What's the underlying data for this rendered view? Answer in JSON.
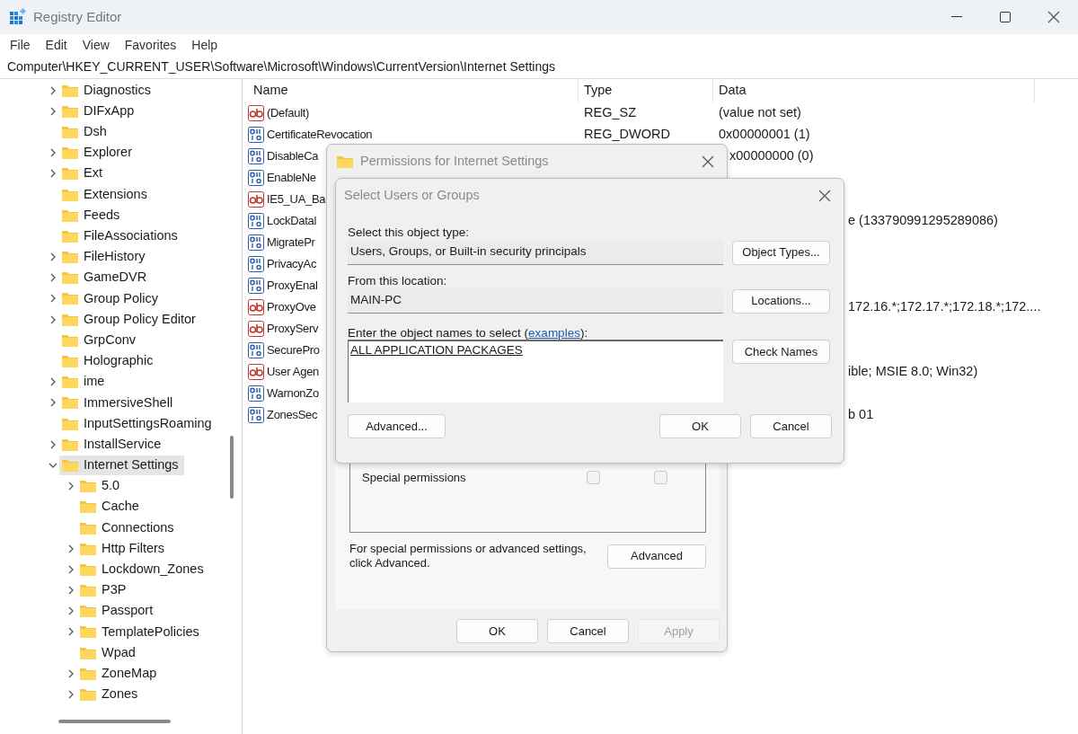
{
  "window": {
    "title": "Registry Editor"
  },
  "menu": [
    "File",
    "Edit",
    "View",
    "Favorites",
    "Help"
  ],
  "address": "Computer\\HKEY_CURRENT_USER\\Software\\Microsoft\\Windows\\CurrentVersion\\Internet Settings",
  "tree": [
    {
      "label": "Diagnostics",
      "expandable": true,
      "expanded": false,
      "selected": false
    },
    {
      "label": "DIFxApp",
      "expandable": true,
      "expanded": false,
      "selected": false
    },
    {
      "label": "Dsh",
      "expandable": false,
      "selected": false
    },
    {
      "label": "Explorer",
      "expandable": true,
      "expanded": false,
      "selected": false
    },
    {
      "label": "Ext",
      "expandable": true,
      "expanded": false,
      "selected": false
    },
    {
      "label": "Extensions",
      "expandable": false,
      "selected": false
    },
    {
      "label": "Feeds",
      "expandable": false,
      "selected": false
    },
    {
      "label": "FileAssociations",
      "expandable": false,
      "selected": false
    },
    {
      "label": "FileHistory",
      "expandable": true,
      "expanded": false,
      "selected": false
    },
    {
      "label": "GameDVR",
      "expandable": true,
      "expanded": false,
      "selected": false
    },
    {
      "label": "Group Policy",
      "expandable": true,
      "expanded": false,
      "selected": false
    },
    {
      "label": "Group Policy Editor",
      "expandable": true,
      "expanded": false,
      "selected": false
    },
    {
      "label": "GrpConv",
      "expandable": false,
      "selected": false
    },
    {
      "label": "Holographic",
      "expandable": false,
      "selected": false
    },
    {
      "label": "ime",
      "expandable": true,
      "expanded": false,
      "selected": false
    },
    {
      "label": "ImmersiveShell",
      "expandable": true,
      "expanded": false,
      "selected": false
    },
    {
      "label": "InputSettingsRoaming",
      "expandable": false,
      "selected": false
    },
    {
      "label": "InstallService",
      "expandable": true,
      "expanded": false,
      "selected": false
    },
    {
      "label": "Internet Settings",
      "expandable": true,
      "expanded": true,
      "selected": true,
      "children": [
        {
          "label": "5.0",
          "expandable": true,
          "expanded": false,
          "selected": false
        },
        {
          "label": "Cache",
          "expandable": false,
          "selected": false
        },
        {
          "label": "Connections",
          "expandable": false,
          "selected": false
        },
        {
          "label": "Http Filters",
          "expandable": true,
          "expanded": false,
          "selected": false
        },
        {
          "label": "Lockdown_Zones",
          "expandable": true,
          "expanded": false,
          "selected": false
        },
        {
          "label": "P3P",
          "expandable": true,
          "expanded": false,
          "selected": false
        },
        {
          "label": "Passport",
          "expandable": true,
          "expanded": false,
          "selected": false
        },
        {
          "label": "TemplatePolicies",
          "expandable": true,
          "expanded": false,
          "selected": false
        },
        {
          "label": "Wpad",
          "expandable": false,
          "selected": false
        },
        {
          "label": "ZoneMap",
          "expandable": true,
          "expanded": false,
          "selected": false
        },
        {
          "label": "Zones",
          "expandable": true,
          "expanded": false,
          "selected": false
        }
      ]
    }
  ],
  "values": {
    "columns": [
      "Name",
      "Type",
      "Data"
    ],
    "rows": [
      {
        "kind": "string",
        "name": "(Default)",
        "type": "REG_SZ",
        "data": "(value not set)"
      },
      {
        "kind": "number",
        "name": "CertificateRevocation",
        "type": "REG_DWORD",
        "data": "0x00000001 (1)"
      },
      {
        "kind": "number",
        "name": "DisableCa",
        "data": "x00000000 (0)"
      },
      {
        "kind": "number",
        "name": "EnableNe"
      },
      {
        "kind": "string",
        "name": "IE5_UA_Ba"
      },
      {
        "kind": "number",
        "name": "LockDatal",
        "data": "e (133790991295289086)"
      },
      {
        "kind": "number",
        "name": "MigratePr"
      },
      {
        "kind": "number",
        "name": "PrivacyAc"
      },
      {
        "kind": "number",
        "name": "ProxyEnal"
      },
      {
        "kind": "string",
        "name": "ProxyOve",
        "data": "172.16.*;172.17.*;172.18.*;172...."
      },
      {
        "kind": "string",
        "name": "ProxyServ"
      },
      {
        "kind": "number",
        "name": "SecurePro"
      },
      {
        "kind": "string",
        "name": "User Agen",
        "data": "ible; MSIE 8.0; Win32)"
      },
      {
        "kind": "number",
        "name": "WarnonZo"
      },
      {
        "kind": "number",
        "name": "ZonesSec",
        "data": "b 01"
      }
    ]
  },
  "permissions_dialog": {
    "title": "Permissions for Internet Settings",
    "special_permissions": {
      "label": "Special permissions",
      "allow": {
        "checked": false,
        "disabled": true
      },
      "deny": {
        "checked": false,
        "disabled": true
      }
    },
    "advanced_note": "For special permissions or advanced settings, click Advanced.",
    "advanced_button": "Advanced",
    "buttons": [
      {
        "label": "OK",
        "disabled": false
      },
      {
        "label": "Cancel",
        "disabled": false
      },
      {
        "label": "Apply",
        "disabled": true
      }
    ]
  },
  "select_dialog": {
    "title": "Select Users or Groups",
    "object_type": {
      "label": "Select this object type:",
      "value": "Users, Groups, or Built-in security principals",
      "button": "Object Types..."
    },
    "location": {
      "label": "From this location:",
      "value": "MAIN-PC",
      "button": "Locations..."
    },
    "names": {
      "label_before": "Enter the object names to select (",
      "link": "examples",
      "label_after": "):",
      "value": "ALL APPLICATION PACKAGES",
      "button": "Check Names"
    },
    "advanced_button": "Advanced...",
    "buttons": [
      "OK",
      "Cancel"
    ]
  }
}
